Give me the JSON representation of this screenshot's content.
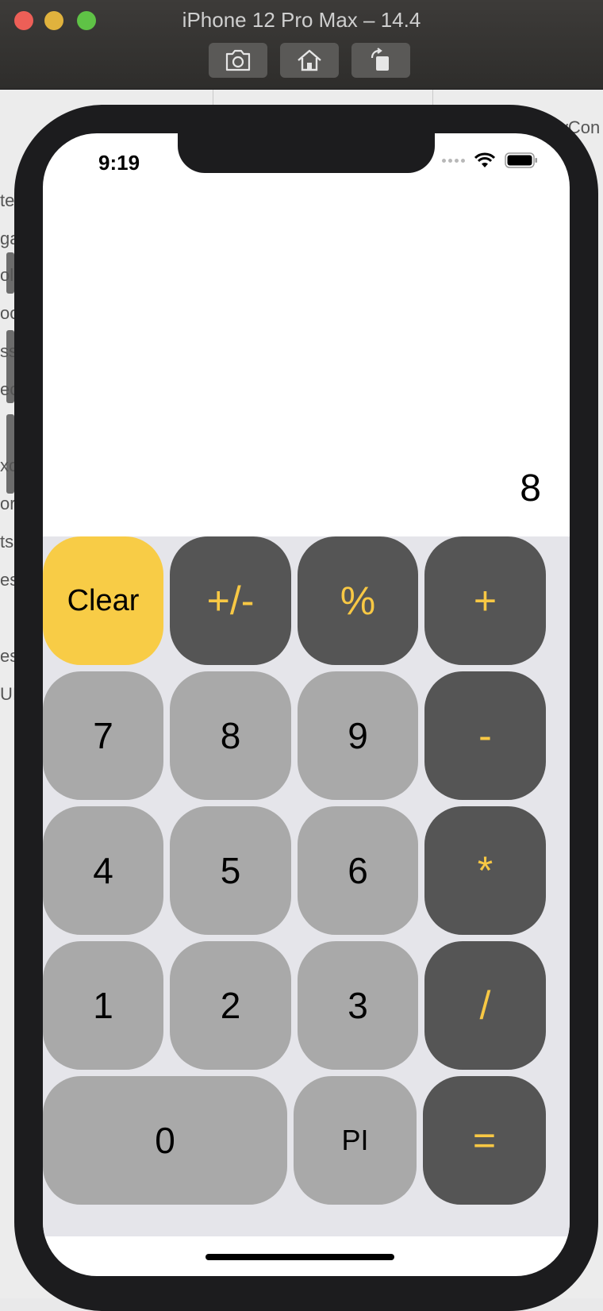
{
  "window": {
    "title": "iPhone 12 Pro Max – 14.4",
    "toolbar": [
      {
        "icon": "screenshot-camera-icon"
      },
      {
        "icon": "home-icon"
      },
      {
        "icon": "rotate-icon"
      }
    ]
  },
  "status_bar": {
    "time": "9:19",
    "icons": [
      "signal-dots-icon",
      "wifi-icon",
      "battery-icon"
    ]
  },
  "display": {
    "value": "8"
  },
  "keypad": {
    "rows": [
      [
        {
          "label": "Clear",
          "kind": "clear"
        },
        {
          "label": "+/-",
          "kind": "op"
        },
        {
          "label": "%",
          "kind": "op"
        },
        {
          "label": "+",
          "kind": "op"
        }
      ],
      [
        {
          "label": "7",
          "kind": "digit"
        },
        {
          "label": "8",
          "kind": "digit"
        },
        {
          "label": "9",
          "kind": "digit"
        },
        {
          "label": "-",
          "kind": "op"
        }
      ],
      [
        {
          "label": "4",
          "kind": "digit"
        },
        {
          "label": "5",
          "kind": "digit"
        },
        {
          "label": "6",
          "kind": "digit"
        },
        {
          "label": "*",
          "kind": "op"
        }
      ],
      [
        {
          "label": "1",
          "kind": "digit"
        },
        {
          "label": "2",
          "kind": "digit"
        },
        {
          "label": "3",
          "kind": "digit"
        },
        {
          "label": "/",
          "kind": "op"
        }
      ],
      [
        {
          "label": "0",
          "kind": "digit"
        },
        {
          "label": "PI",
          "kind": "digit"
        },
        {
          "label": "=",
          "kind": "op"
        }
      ]
    ]
  },
  "colors": {
    "clear_key": "#f8cc46",
    "operator_key": "#555555",
    "operator_text": "#f8c844",
    "digit_key": "#a9a9a9",
    "keypad_background": "#e5e5ea"
  },
  "background_fragments": [
    "te",
    "ga",
    "ol",
    "oo",
    "ss",
    "ec",
    "xc",
    "or",
    "ts",
    "es",
    "es",
    "UI",
    "wCon"
  ]
}
